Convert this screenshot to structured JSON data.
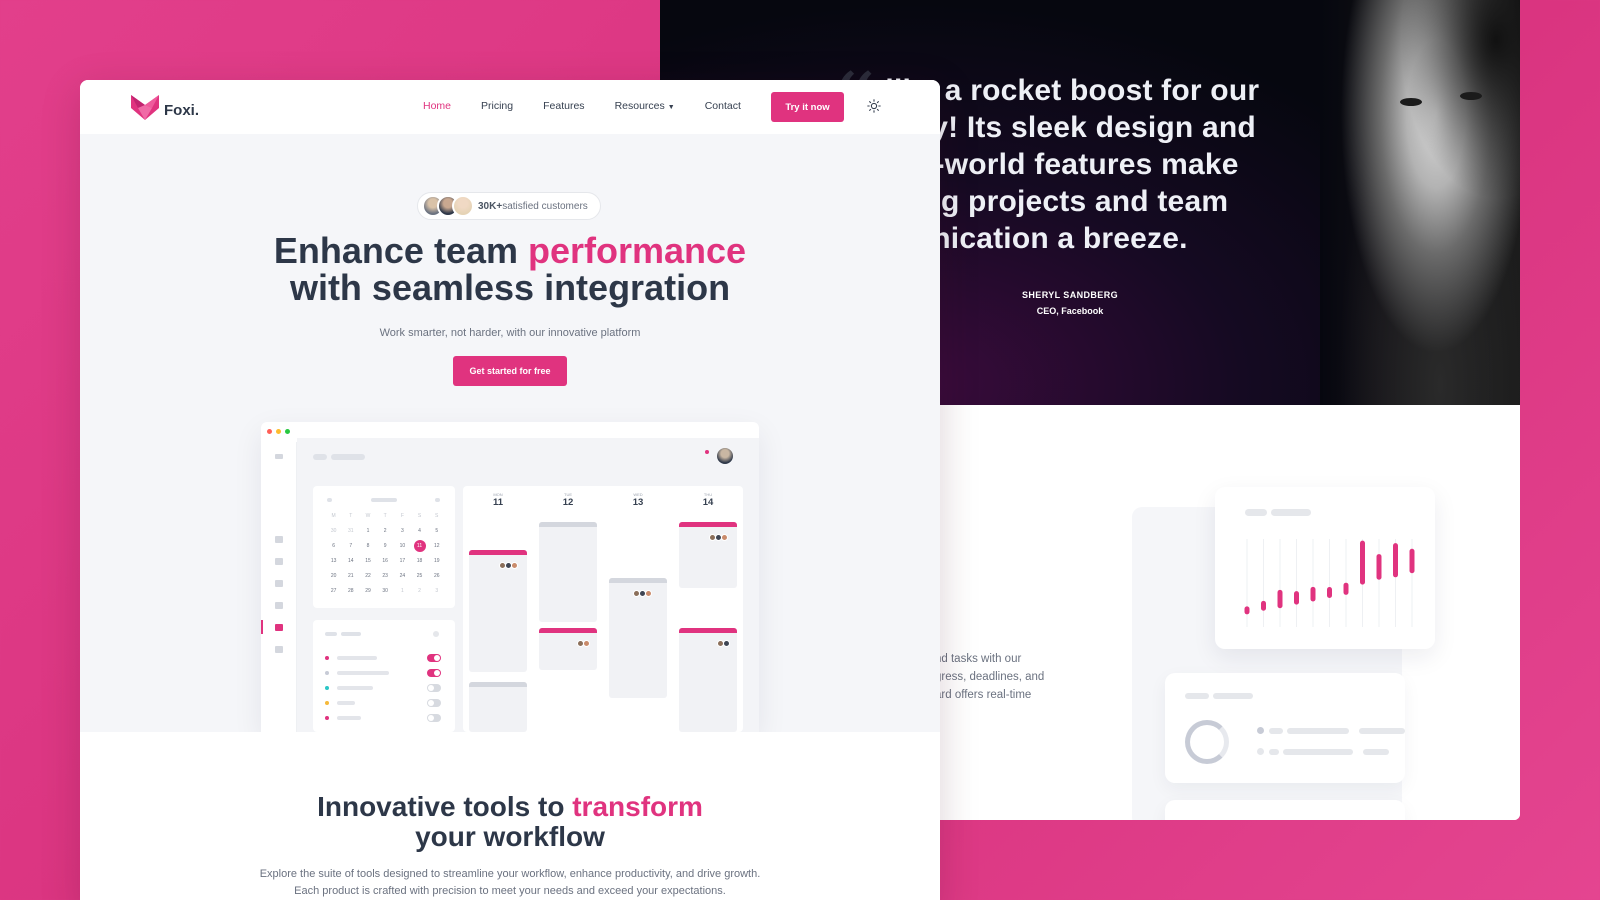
{
  "testimonial": {
    "quote_lines": [
      "s like a rocket boost for our",
      "ctivity! Its sleek design and",
      "f-this-world features make",
      "naging projects and team",
      "mmunication a breeze."
    ],
    "author_name": "SHERYL SANDBERG",
    "author_role": "CEO, Facebook"
  },
  "feature": {
    "text_lines": [
      "nd tasks with our",
      "gress, deadlines, and",
      "ard offers real-time"
    ],
    "chart_bars": [
      12,
      16,
      30,
      22,
      24,
      18,
      20,
      72,
      42,
      56,
      40
    ]
  },
  "nav": {
    "brand": "Foxi.",
    "links": [
      {
        "label": "Home",
        "active": true
      },
      {
        "label": "Pricing"
      },
      {
        "label": "Features"
      },
      {
        "label": "Resources",
        "chevron": "chevron-down-icon"
      },
      {
        "label": "Contact"
      }
    ],
    "cta": "Try it now",
    "theme_icon": "sun-icon"
  },
  "hero": {
    "badge_count": "30K+",
    "badge_text": "satisfied customers",
    "title_part1": "Enhance team ",
    "title_accent": "performance",
    "title_line2": "with seamless integration",
    "subtitle": "Work smarter, not harder, with our innovative platform",
    "cta": "Get started for free"
  },
  "preview": {
    "days": [
      {
        "name": "MON",
        "num": "11"
      },
      {
        "name": "TUE",
        "num": "12"
      },
      {
        "name": "WED",
        "num": "13"
      },
      {
        "name": "THU",
        "num": "14"
      }
    ],
    "mini_calendar": {
      "weekdays": [
        "M",
        "T",
        "W",
        "T",
        "F",
        "S",
        "S"
      ],
      "cells": [
        "30",
        "31",
        "1",
        "2",
        "3",
        "4",
        "5",
        "6",
        "7",
        "8",
        "9",
        "10",
        "11",
        "12",
        "13",
        "14",
        "15",
        "16",
        "17",
        "18",
        "19",
        "20",
        "21",
        "22",
        "23",
        "24",
        "25",
        "26",
        "27",
        "28",
        "29",
        "30",
        "1",
        "2",
        "3"
      ],
      "selected": "11"
    }
  },
  "tools": {
    "title_part1": "Innovative tools to ",
    "title_accent": "transform",
    "title_line2": "your workflow",
    "desc_line1": "Explore the suite of tools designed to streamline your workflow, enhance productivity, and drive growth.",
    "desc_line2": "Each product is crafted with precision to meet your needs and exceed your expectations."
  },
  "colors": {
    "accent": "#e0337f",
    "background": "#dd3a86",
    "heading": "#2d3748"
  }
}
